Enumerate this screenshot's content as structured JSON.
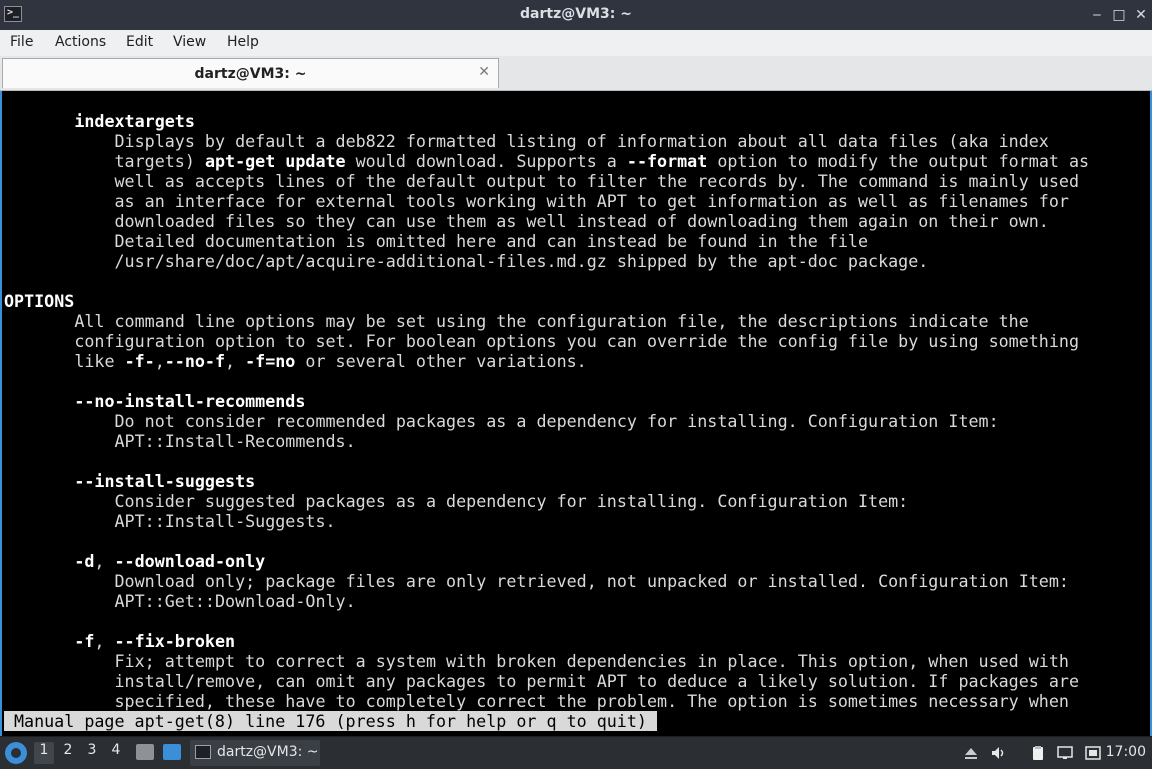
{
  "window": {
    "title": "dartz@VM3: ~",
    "minimize_glyph": "‒",
    "maximize_glyph": "□",
    "close_glyph": "✕"
  },
  "menu": [
    "File",
    "Actions",
    "Edit",
    "View",
    "Help"
  ],
  "tab": {
    "label": "dartz@VM3: ~",
    "close_glyph": "✕"
  },
  "terminal": {
    "lines": [
      [
        [
          "       ",
          ""
        ],
        [
          "indextargets",
          "b"
        ]
      ],
      [
        [
          "           Displays by default a deb822 formatted listing of information about all data files (aka index",
          ""
        ]
      ],
      [
        [
          "           targets) ",
          ""
        ],
        [
          "apt-get update",
          "b"
        ],
        [
          " would download. Supports a ",
          ""
        ],
        [
          "--format",
          "b"
        ],
        [
          " option to modify the output format as",
          ""
        ]
      ],
      [
        [
          "           well as accepts lines of the default output to filter the records by. The command is mainly used",
          ""
        ]
      ],
      [
        [
          "           as an interface for external tools working with APT to get information as well as filenames for",
          ""
        ]
      ],
      [
        [
          "           downloaded files so they can use them as well instead of downloading them again on their own.",
          ""
        ]
      ],
      [
        [
          "           Detailed documentation is omitted here and can instead be found in the file",
          ""
        ]
      ],
      [
        [
          "           /usr/share/doc/apt/acquire-additional-files.md.gz shipped by the apt-doc package.",
          ""
        ]
      ],
      [
        [
          "",
          ""
        ]
      ],
      [
        [
          "OPTIONS",
          "b"
        ]
      ],
      [
        [
          "       All command line options may be set using the configuration file, the descriptions indicate the",
          ""
        ]
      ],
      [
        [
          "       configuration option to set. For boolean options you can override the config file by using something",
          ""
        ]
      ],
      [
        [
          "       like ",
          ""
        ],
        [
          "-f-",
          "b"
        ],
        [
          ",",
          ""
        ],
        [
          "--no-f",
          "b"
        ],
        [
          ", ",
          ""
        ],
        [
          "-f=no",
          "b"
        ],
        [
          " or several other variations.",
          ""
        ]
      ],
      [
        [
          "",
          ""
        ]
      ],
      [
        [
          "       ",
          ""
        ],
        [
          "--no-install-recommends",
          "b"
        ]
      ],
      [
        [
          "           Do not consider recommended packages as a dependency for installing. Configuration Item:",
          ""
        ]
      ],
      [
        [
          "           APT::Install-Recommends.",
          ""
        ]
      ],
      [
        [
          "",
          ""
        ]
      ],
      [
        [
          "       ",
          ""
        ],
        [
          "--install-suggests",
          "b"
        ]
      ],
      [
        [
          "           Consider suggested packages as a dependency for installing. Configuration Item:",
          ""
        ]
      ],
      [
        [
          "           APT::Install-Suggests.",
          ""
        ]
      ],
      [
        [
          "",
          ""
        ]
      ],
      [
        [
          "       ",
          ""
        ],
        [
          "-d",
          "b"
        ],
        [
          ", ",
          ""
        ],
        [
          "--download-only",
          "b"
        ]
      ],
      [
        [
          "           Download only; package files are only retrieved, not unpacked or installed. Configuration Item:",
          ""
        ]
      ],
      [
        [
          "           APT::Get::Download-Only.",
          ""
        ]
      ],
      [
        [
          "",
          ""
        ]
      ],
      [
        [
          "       ",
          ""
        ],
        [
          "-f",
          "b"
        ],
        [
          ", ",
          ""
        ],
        [
          "--fix-broken",
          "b"
        ]
      ],
      [
        [
          "           Fix; attempt to correct a system with broken dependencies in place. This option, when used with",
          ""
        ]
      ],
      [
        [
          "           install/remove, can omit any packages to permit APT to deduce a likely solution. If packages are",
          ""
        ]
      ],
      [
        [
          "           specified, these have to completely correct the problem. The option is sometimes necessary when",
          ""
        ]
      ]
    ],
    "status": "Manual page apt-get(8) line 176 (press h for help or q to quit)"
  },
  "taskbar": {
    "workspaces": [
      "1",
      "2",
      "3",
      "4"
    ],
    "active_workspace": "1",
    "task_label": "dartz@VM3: ~",
    "clock": "17:00",
    "tray_icons": [
      "removable-media-icon",
      "volume-icon",
      "clipboard-icon",
      "network-icon",
      "notification-icon"
    ]
  },
  "colors": {
    "accent": "#3b8ed8",
    "terminal_bg": "#000000",
    "terminal_fg": "#d9d9d9",
    "titlebar": "#2f343f"
  }
}
